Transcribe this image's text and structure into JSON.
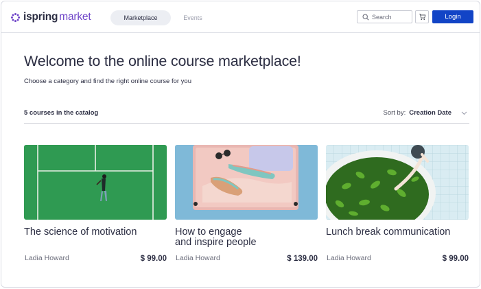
{
  "header": {
    "logo_text": "ispring",
    "logo_accent": "market",
    "tabs": [
      {
        "label": "Marketplace",
        "active": true
      },
      {
        "label": "Events",
        "active": false
      }
    ],
    "search_placeholder": "Search",
    "login_label": "Login",
    "colors": {
      "brand_purple": "#6f45c8",
      "login_blue": "#1244c6"
    }
  },
  "main": {
    "title": "Welcome to the online course marketplace!",
    "subtitle": "Choose a category and find the right online course for you",
    "catalog_count": "5 courses in the catalog",
    "sort_label": "Sort by:",
    "sort_value": "Creation Date"
  },
  "courses": [
    {
      "title": "The science of motivation",
      "author": "Ladia Howard",
      "price": "$ 99.00",
      "image": "tennis-court-photo"
    },
    {
      "title_line1": "How to engage",
      "title_line2": "and inspire people",
      "author": "Ladia Howard",
      "price": "$ 139.00",
      "image": "suitcase-photo"
    },
    {
      "title": "Lunch break communication",
      "author": "Ladia Howard",
      "price": "$ 99.00",
      "image": "plant-pot-photo"
    }
  ],
  "icons": [
    "logo-flower-icon",
    "search-icon",
    "cart-icon",
    "chevron-down-icon"
  ]
}
